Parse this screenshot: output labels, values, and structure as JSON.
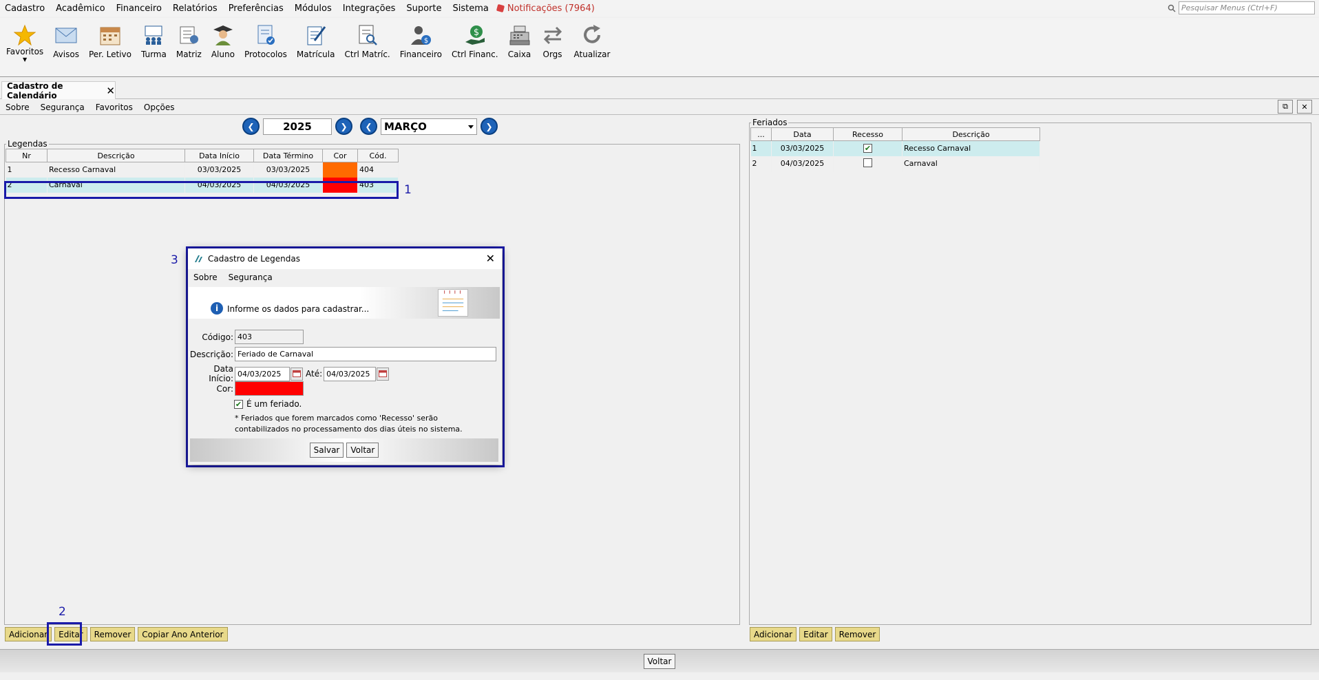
{
  "menu": {
    "items": [
      "Cadastro",
      "Acadêmico",
      "Financeiro",
      "Relatórios",
      "Preferências",
      "Módulos",
      "Integrações",
      "Suporte",
      "Sistema"
    ],
    "notifications": "Notificações (7964)",
    "search_placeholder": "Pesquisar Menus (Ctrl+F)"
  },
  "toolbar": {
    "favoritos": "Favoritos",
    "items": [
      "Avisos",
      "Per. Letivo",
      "Turma",
      "Matriz",
      "Aluno",
      "Protocolos",
      "Matrícula",
      "Ctrl Matríc.",
      "Financeiro",
      "Ctrl Financ.",
      "Caixa",
      "Orgs",
      "Atualizar"
    ]
  },
  "tab": {
    "label": "Cadastro de Calendário"
  },
  "submenu": [
    "Sobre",
    "Segurança",
    "Favoritos",
    "Opções"
  ],
  "nav": {
    "year": "2025",
    "month": "MARÇO"
  },
  "legendas": {
    "title": "Legendas",
    "columns": [
      "Nr",
      "Descrição",
      "Data Início",
      "Data Término",
      "Cor",
      "Cód."
    ],
    "rows": [
      {
        "nr": "1",
        "descricao": "Recesso Carnaval",
        "inicio": "03/03/2025",
        "termino": "03/03/2025",
        "cor": "#ff6a00",
        "cod": "404"
      },
      {
        "nr": "2",
        "descricao": "Carnaval",
        "inicio": "04/03/2025",
        "termino": "04/03/2025",
        "cor": "#ff0000",
        "cod": "403"
      }
    ],
    "buttons": [
      "Adicionar",
      "Editar",
      "Remover",
      "Copiar Ano Anterior"
    ]
  },
  "feriados": {
    "title": "Feriados",
    "columns": [
      "...",
      "Data",
      "Recesso",
      "Descrição"
    ],
    "rows": [
      {
        "nr": "1",
        "data": "03/03/2025",
        "recesso": true,
        "descricao": "Recesso Carnaval"
      },
      {
        "nr": "2",
        "data": "04/03/2025",
        "recesso": false,
        "descricao": "Carnaval"
      }
    ],
    "buttons": [
      "Adicionar",
      "Editar",
      "Remover"
    ]
  },
  "bottom": {
    "voltar": "Voltar"
  },
  "annotations": [
    "1",
    "2",
    "3"
  ],
  "dialog": {
    "title": "Cadastro de Legendas",
    "menu": [
      "Sobre",
      "Segurança"
    ],
    "banner": "Informe os dados para cadastrar...",
    "codigo_label": "Código:",
    "codigo": "403",
    "descricao_label": "Descrição:",
    "descricao": "Feriado de Carnaval",
    "inicio_label": "Data Início:",
    "inicio": "04/03/2025",
    "ate_label": "Até:",
    "ate": "04/03/2025",
    "cor_label": "Cor:",
    "cor": "#ff0000",
    "feriado_label": "É um feriado.",
    "feriado_checked": true,
    "note": "* Feriados que forem marcados como 'Recesso' serão contabilizados no processamento dos dias úteis no sistema.",
    "salvar": "Salvar",
    "voltar": "Voltar"
  }
}
